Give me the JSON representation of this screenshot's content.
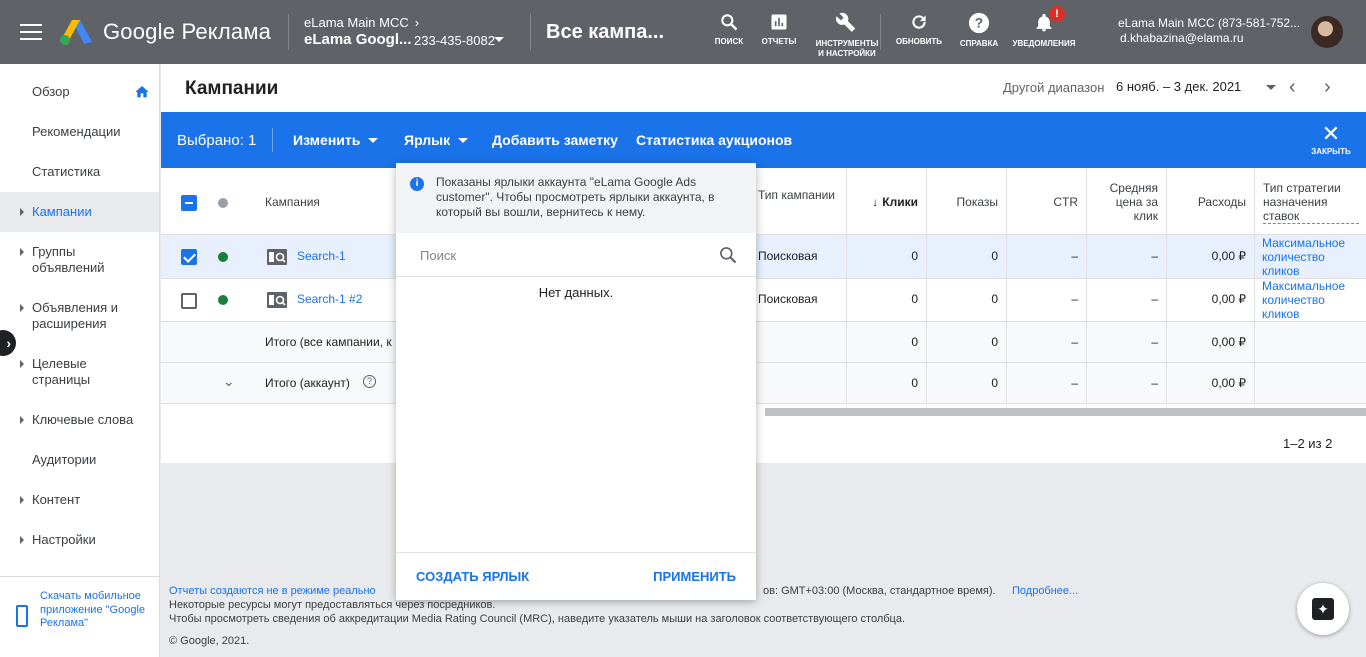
{
  "header": {
    "brand": "Google Реклама",
    "account_parent": "eLama Main MCC",
    "account_name": "eLama Googl...",
    "account_id": "233-435-8082",
    "page_title": "Все кампа...",
    "tools": [
      {
        "label": "ПОИСК",
        "icon": "search-icon"
      },
      {
        "label": "ОТЧЕТЫ",
        "icon": "reports-icon"
      },
      {
        "label": "ИНСТРУМЕНТЫ И НАСТРОЙКИ",
        "icon": "wrench-icon"
      },
      {
        "label": "ОБНОВИТЬ",
        "icon": "refresh-icon"
      },
      {
        "label": "СПРАВКА",
        "icon": "help-icon"
      },
      {
        "label": "УВЕДОМЛЕНИЯ",
        "icon": "bell-icon",
        "badge": "!"
      }
    ],
    "user_account": "eLama Main MCC (873-581-752...",
    "user_email": "d.khabazina@elama.ru",
    "accent": "#1a73e8"
  },
  "sidebar": {
    "items": [
      {
        "label": "Обзор"
      },
      {
        "label": "Рекомендации"
      },
      {
        "label": "Статистика"
      },
      {
        "label": "Кампании"
      },
      {
        "label": "Группы объявлений"
      },
      {
        "label": "Объявления и расширения"
      },
      {
        "label": "Целевые страницы"
      },
      {
        "label": "Ключевые слова"
      },
      {
        "label": "Аудитории"
      },
      {
        "label": "Контент"
      },
      {
        "label": "Настройки"
      }
    ],
    "app_promo": "Скачать мобильное приложение \"Google Реклама\""
  },
  "main": {
    "title": "Кампании",
    "range_label": "Другой диапазон",
    "range_value": "6 нояб. – 3 дек. 2021",
    "selection": {
      "count": "Выбрано: 1",
      "edit": "Изменить",
      "label": "Ярлык",
      "add_note": "Добавить заметку",
      "auction": "Статистика аукционов",
      "close": "ЗАКРЫТЬ"
    },
    "table": {
      "headers": {
        "campaign": "Кампания",
        "type": "Тип кампании",
        "clicks": "Клики",
        "impressions": "Показы",
        "ctr": "CTR",
        "avg_cpc": "Средняя цена за клик",
        "cost": "Расходы",
        "bid_strategy": "Тип стратегии назначения ставок"
      },
      "rows": [
        {
          "name": "Search-1",
          "type": "Поисковая",
          "clicks": "0",
          "impressions": "0",
          "ctr": "–",
          "avg_cpc": "–",
          "cost": "0,00 ₽",
          "strategy": "Максимальное количество кликов"
        },
        {
          "name": "Search-1 #2",
          "type": "Поисковая",
          "clicks": "0",
          "impressions": "0",
          "ctr": "–",
          "avg_cpc": "–",
          "cost": "0,00 ₽",
          "strategy": "Максимальное количество кликов"
        }
      ],
      "total_all": {
        "label": "Итого (все кампании, к",
        "clicks": "0",
        "impressions": "0",
        "ctr": "–",
        "avg_cpc": "–",
        "cost": "0,00 ₽"
      },
      "total_account": {
        "label": "Итого (аккаунт)",
        "clicks": "0",
        "impressions": "0",
        "ctr": "–",
        "avg_cpc": "–",
        "cost": "0,00 ₽"
      },
      "pager": "1–2 из 2"
    }
  },
  "popup": {
    "info": "Показаны ярлыки аккаунта \"eLama Google Ads customer\". Чтобы просмотреть ярлыки аккаунта, в который вы вошли, вернитесь к нему.",
    "search_placeholder": "Поиск",
    "empty": "Нет данных.",
    "create": "СОЗДАТЬ ЯРЛЫК",
    "apply": "ПРИМЕНИТЬ"
  },
  "footer": {
    "line1_link": "Отчеты создаются не в режиме реально",
    "line1_mid": "ов: GMT+03:00 (Москва, стандартное время).",
    "line1_more": "Подробнее...",
    "line2": "Некоторые ресурсы могут предоставляться через посредников.",
    "line3": "Чтобы просмотреть сведения об аккредитации Media Rating Council (MRC), наведите указатель мыши на заголовок соответствующего столбца.",
    "copyright": "© Google, 2021."
  }
}
